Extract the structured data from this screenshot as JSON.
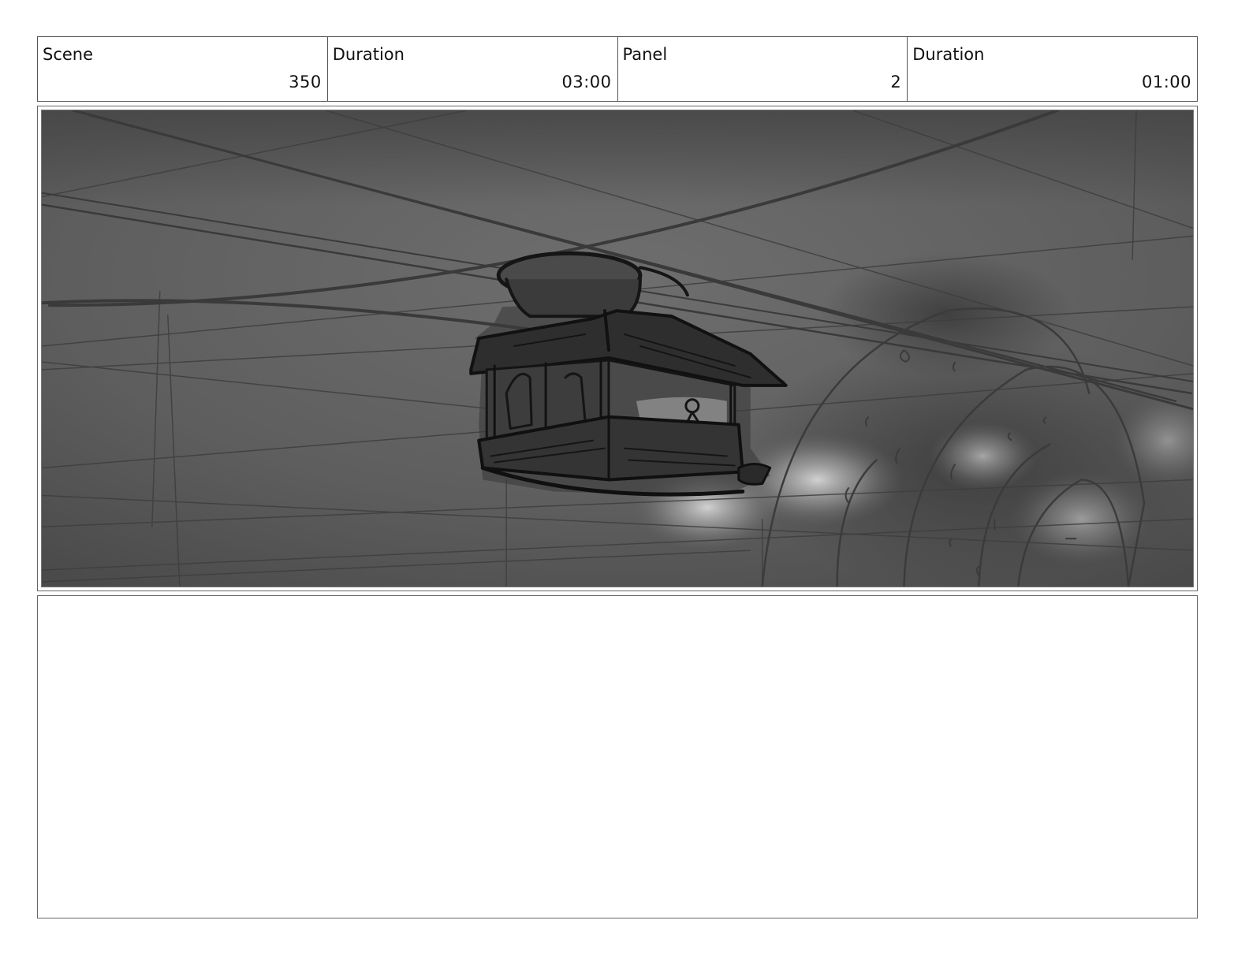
{
  "header": {
    "scene_label": "Scene",
    "scene_value": "350",
    "scene_duration_label": "Duration",
    "scene_duration_value": "03:00",
    "panel_label": "Panel",
    "panel_value": "2",
    "panel_duration_label": "Duration",
    "panel_duration_value": "01:00"
  },
  "notes": {
    "text": ""
  }
}
